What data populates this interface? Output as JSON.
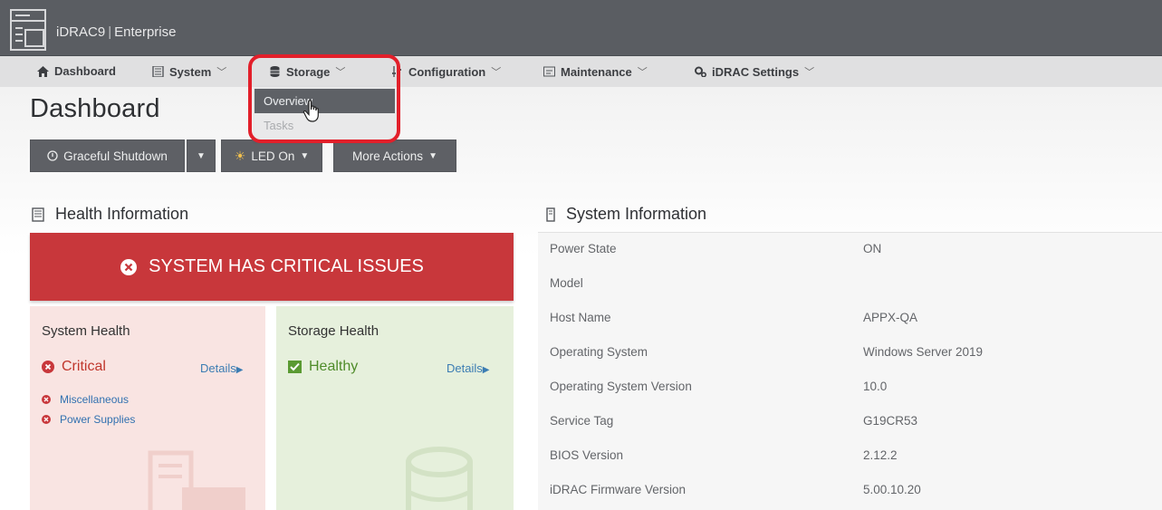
{
  "app": {
    "title": "iDRAC9",
    "edition": "Enterprise"
  },
  "nav": {
    "dashboard": "Dashboard",
    "system": "System",
    "storage": "Storage",
    "configuration": "Configuration",
    "maintenance": "Maintenance",
    "idrac_settings": "iDRAC Settings"
  },
  "storage_menu": {
    "overview": "Overview",
    "tasks": "Tasks"
  },
  "page": {
    "title": "Dashboard"
  },
  "actions": {
    "graceful_shutdown": "Graceful Shutdown",
    "led_on": "LED On",
    "more_actions": "More Actions"
  },
  "health": {
    "heading": "Health Information",
    "banner": "SYSTEM HAS CRITICAL ISSUES",
    "system": {
      "title": "System Health",
      "status": "Critical",
      "details": "Details",
      "issues": [
        "Miscellaneous",
        "Power Supplies"
      ]
    },
    "storage": {
      "title": "Storage Health",
      "status": "Healthy",
      "details": "Details"
    }
  },
  "system_info": {
    "heading": "System Information",
    "rows": [
      {
        "label": "Power State",
        "value": "ON"
      },
      {
        "label": "Model",
        "value": ""
      },
      {
        "label": "Host Name",
        "value": "APPX-QA"
      },
      {
        "label": "Operating System",
        "value": "Windows Server 2019"
      },
      {
        "label": "Operating System Version",
        "value": "10.0"
      },
      {
        "label": "Service Tag",
        "value": "G19CR53"
      },
      {
        "label": "BIOS Version",
        "value": "2.12.2"
      },
      {
        "label": "iDRAC Firmware Version",
        "value": "5.00.10.20"
      }
    ]
  },
  "colors": {
    "titlebar": "#5a5d62",
    "navbar": "#e0e0e1",
    "critical": "#c8373b",
    "highlight": "#e21f2a",
    "link": "#3c7db3",
    "healthy": "#4f8c2a"
  }
}
